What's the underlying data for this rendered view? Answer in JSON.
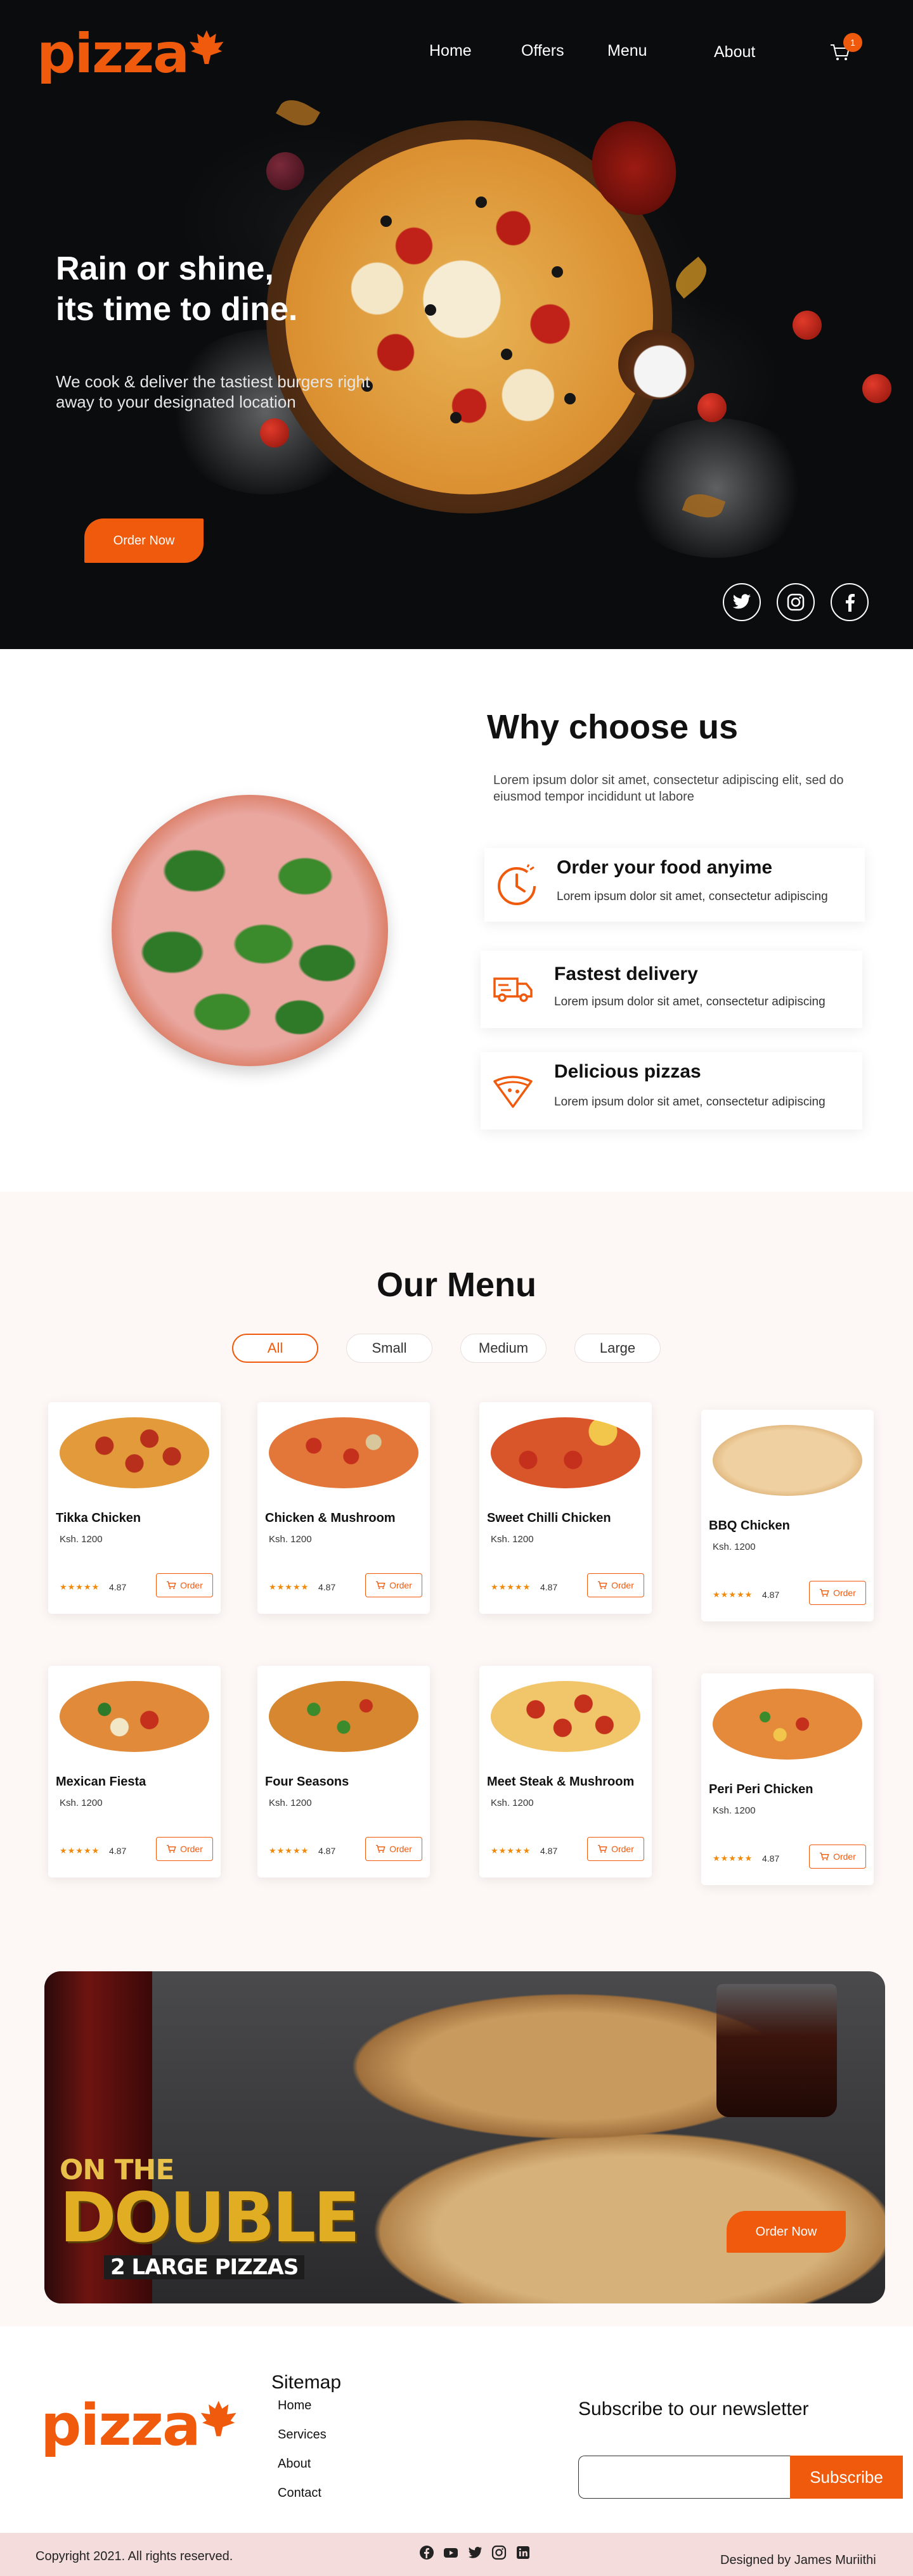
{
  "brand": {
    "logo_text": "pizza",
    "accent": "#ef5a0c"
  },
  "nav": {
    "items": [
      {
        "label": "Home"
      },
      {
        "label": "Offers"
      },
      {
        "label": "Menu"
      },
      {
        "label": "About"
      }
    ],
    "cart_icon": "cart-icon",
    "cart_count": "1"
  },
  "hero": {
    "title_line1": "Rain or shine,",
    "title_line2": "its time to dine.",
    "subtitle": "We cook & deliver the tastiest burgers right away to your designated location",
    "cta": "Order Now",
    "social": [
      "twitter-icon",
      "instagram-icon",
      "facebook-icon"
    ]
  },
  "why": {
    "title": "Why choose us",
    "description": "Lorem ipsum dolor sit amet, consectetur adipiscing elit, sed do eiusmod tempor incididunt ut labore",
    "features": [
      {
        "icon": "clock-icon",
        "title": "Order your food anyime",
        "text": "Lorem ipsum dolor sit amet, consectetur adipiscing"
      },
      {
        "icon": "delivery-truck-icon",
        "title": "Fastest delivery",
        "text": "Lorem ipsum dolor sit amet, consectetur adipiscing"
      },
      {
        "icon": "pizza-slice-icon",
        "title": "Delicious pizzas",
        "text": "Lorem ipsum dolor sit amet, consectetur adipiscing"
      }
    ]
  },
  "menu": {
    "title": "Our Menu",
    "filters": [
      {
        "label": "All",
        "active": true
      },
      {
        "label": "Small",
        "active": false
      },
      {
        "label": "Medium",
        "active": false
      },
      {
        "label": "Large",
        "active": false
      }
    ],
    "items": [
      {
        "name": "Tikka Chicken",
        "price": "Ksh. 1200",
        "stars": "★★★★★",
        "rating": "4.87",
        "order": "Order"
      },
      {
        "name": "Chicken & Mushroom",
        "price": "Ksh. 1200",
        "stars": "★★★★★",
        "rating": "4.87",
        "order": "Order"
      },
      {
        "name": "Sweet Chilli Chicken",
        "price": "Ksh. 1200",
        "stars": "★★★★★",
        "rating": "4.87",
        "order": "Order"
      },
      {
        "name": "BBQ Chicken",
        "price": "Ksh. 1200",
        "stars": "★★★★★",
        "rating": "4.87",
        "order": "Order"
      },
      {
        "name": "Mexican Fiesta",
        "price": "Ksh. 1200",
        "stars": "★★★★★",
        "rating": "4.87",
        "order": "Order"
      },
      {
        "name": "Four Seasons",
        "price": "Ksh. 1200",
        "stars": "★★★★★",
        "rating": "4.87",
        "order": "Order"
      },
      {
        "name": "Meet Steak & Mushroom",
        "price": "Ksh. 1200",
        "stars": "★★★★★",
        "rating": "4.87",
        "order": "Order"
      },
      {
        "name": "Peri Peri Chicken",
        "price": "Ksh. 1200",
        "stars": "★★★★★",
        "rating": "4.87",
        "order": "Order"
      }
    ]
  },
  "promo": {
    "line1": "ON THE",
    "line2": "DOUBLE",
    "line3": "2 LARGE PIZZAS",
    "cta": "Order Now"
  },
  "footer": {
    "logo_text": "pizza",
    "sitemap_title": "Sitemap",
    "sitemap_links": [
      "Home",
      "Services",
      "About",
      "Contact"
    ],
    "newsletter_title": "Subscribe to our newsletter",
    "newsletter_placeholder": "",
    "subscribe": "Subscribe",
    "copyright": "Copyright 2021. All rights reserved.",
    "designer": "Designed by James Muriithi",
    "social": [
      "facebook-icon",
      "youtube-icon",
      "twitter-icon",
      "instagram-icon",
      "linkedin-icon"
    ]
  }
}
